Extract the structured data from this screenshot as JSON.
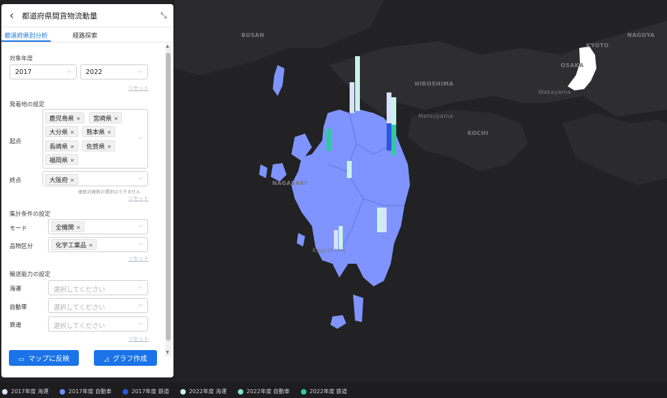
{
  "panel": {
    "title": "都道府県間貨物流動量",
    "back_icon": "‹",
    "collapse_icon": "⤡",
    "tabs": [
      "都道府県別分析",
      "経路探索"
    ],
    "year_section": "対象年度",
    "year_from": "2017",
    "year_to": "2022",
    "reset": "リセット",
    "od_section": "発着地の設定",
    "origin_label": "起点",
    "origins": [
      "鹿児島県",
      "宮崎県",
      "大分県",
      "熊本県",
      "長崎県",
      "佐賀県",
      "福岡県"
    ],
    "dest_label": "終点",
    "destinations": [
      "大阪府"
    ],
    "od_note": "複数対複数の選択はできません",
    "agg_section": "集計条件の設定",
    "mode_label": "モード",
    "mode_value": "全機関",
    "item_label": "品物区分",
    "item_value": "化学工業品",
    "cap_section": "輸送能力の設定",
    "cap_fields": [
      {
        "label": "海運",
        "placeholder": "選択してください"
      },
      {
        "label": "自動車",
        "placeholder": "選択してください"
      },
      {
        "label": "鉄道",
        "placeholder": "選択してください"
      }
    ],
    "apply_button": "マップに反映",
    "graph_button": "グラフ作成",
    "map_icon": "▭",
    "chart_icon": "◿"
  },
  "map": {
    "cities": [
      "BUSAN",
      "HIROSHIMA",
      "OSAKA",
      "KYOTO",
      "NAGOYA",
      "Wakayama",
      "KOCHI",
      "Matsuyama",
      "NAGASAKI",
      "Kagoshima"
    ],
    "colors": {
      "kyushu": "#7f94ff",
      "osaka": "#ffffff",
      "background": "#222224",
      "land": "#2e2e31"
    }
  },
  "legend": [
    {
      "label": "2017年度 海運",
      "color": "#d9e2ff"
    },
    {
      "label": "2017年度 自動車",
      "color": "#6f8cff"
    },
    {
      "label": "2017年度 鉄道",
      "color": "#2d55e0"
    },
    {
      "label": "2022年度 海運",
      "color": "#c9f2ea"
    },
    {
      "label": "2022年度 自動車",
      "color": "#7fe3cd"
    },
    {
      "label": "2022年度 鉄道",
      "color": "#31c9a3"
    }
  ]
}
